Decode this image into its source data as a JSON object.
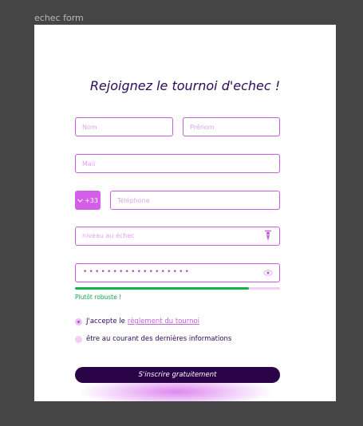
{
  "frame": {
    "label": "echec form"
  },
  "form": {
    "title": "Rejoignez le tournoi d'echec !",
    "nom_placeholder": "Nom",
    "prenom_placeholder": "Prénom",
    "mail_placeholder": "Mail",
    "phone_prefix": "+33",
    "phone_placeholder": "Téléphone",
    "niveau_placeholder": "niveau au échec",
    "password_mask": "••••••••••••••••••",
    "password_strength": 0.85,
    "strength_label": "Plutôt robuste !",
    "accept_label": "J'accepte le",
    "accept_link": "règlement du tournoi",
    "newsletter_label": "être au courant des dernières informations",
    "submit_label": "S'inscrire gratuitement"
  },
  "colors": {
    "accent": "#c55fde",
    "primary_dark": "#2a0446",
    "success": "#0fb548"
  },
  "icons": {
    "prefix": "chevron-down-icon",
    "select": "chess-pawn-icon",
    "password": "eye-icon"
  }
}
